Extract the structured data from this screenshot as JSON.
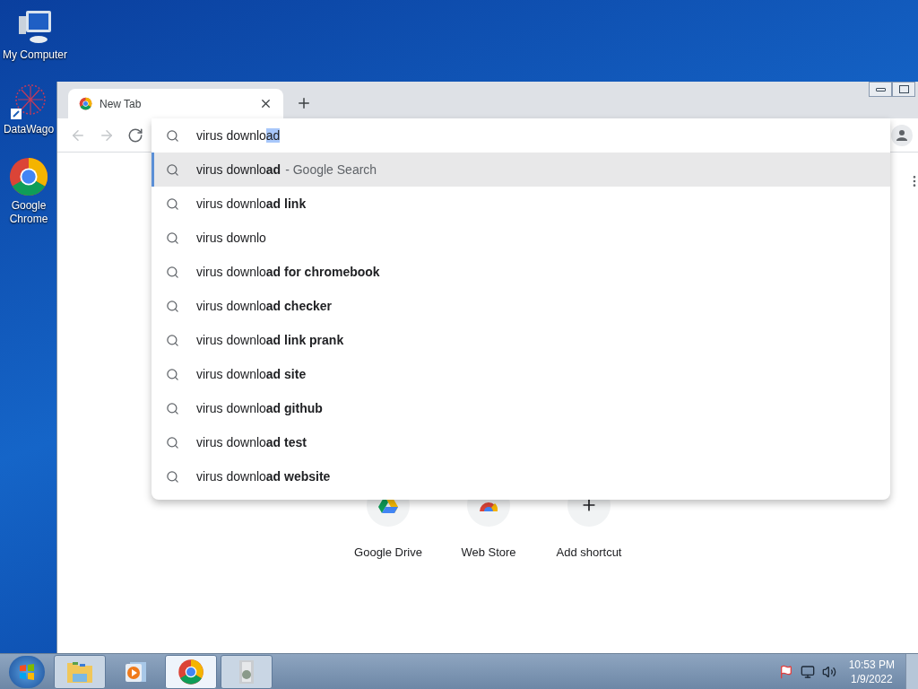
{
  "desktop_icons": [
    {
      "label": "My Computer",
      "kind": "computer"
    },
    {
      "label": "DataWago",
      "kind": "datawagon"
    },
    {
      "label": "Google Chrome",
      "kind": "chrome"
    }
  ],
  "browser": {
    "tabs": [
      {
        "title": "New Tab",
        "selected": true
      }
    ],
    "nav": [
      {
        "kind": "back",
        "disabled": true
      },
      {
        "kind": "forward",
        "disabled": true
      },
      {
        "kind": "reload",
        "disabled": false
      }
    ],
    "omnibox": {
      "text": "virus downlo",
      "selected_text": "ad"
    },
    "suggestions": [
      {
        "text": "virus downlo**ad**",
        "suffix": "- Google Search",
        "selected": true
      },
      {
        "text": "virus downlo**ad link**",
        "selected": false
      },
      {
        "text": "virus downlo",
        "selected": false
      },
      {
        "text": "virus downlo**ad for chromebook**",
        "selected": false
      },
      {
        "text": "virus downlo**ad checker**",
        "selected": false
      },
      {
        "text": "virus downlo**ad link prank**",
        "selected": false
      },
      {
        "text": "virus downlo**ad site**",
        "selected": false
      },
      {
        "text": "virus downlo**ad github**",
        "selected": false
      },
      {
        "text": "virus downlo**ad test**",
        "selected": false
      },
      {
        "text": "virus downlo**ad website**",
        "selected": false
      }
    ],
    "shortcuts": [
      {
        "label": "Google Drive",
        "kind": "drive"
      },
      {
        "label": "Web Store",
        "kind": "webstore"
      },
      {
        "label": "Add shortcut",
        "kind": "add"
      }
    ]
  },
  "taskbar": {
    "apps": [
      {
        "kind": "explorer",
        "running": true,
        "selected": false
      },
      {
        "kind": "media",
        "running": false,
        "selected": false
      },
      {
        "kind": "chrome",
        "running": true,
        "selected": true
      },
      {
        "kind": "installer",
        "running": true,
        "selected": false
      }
    ],
    "clock": {
      "time": "10:53 PM",
      "date": "1/9/2022"
    }
  }
}
